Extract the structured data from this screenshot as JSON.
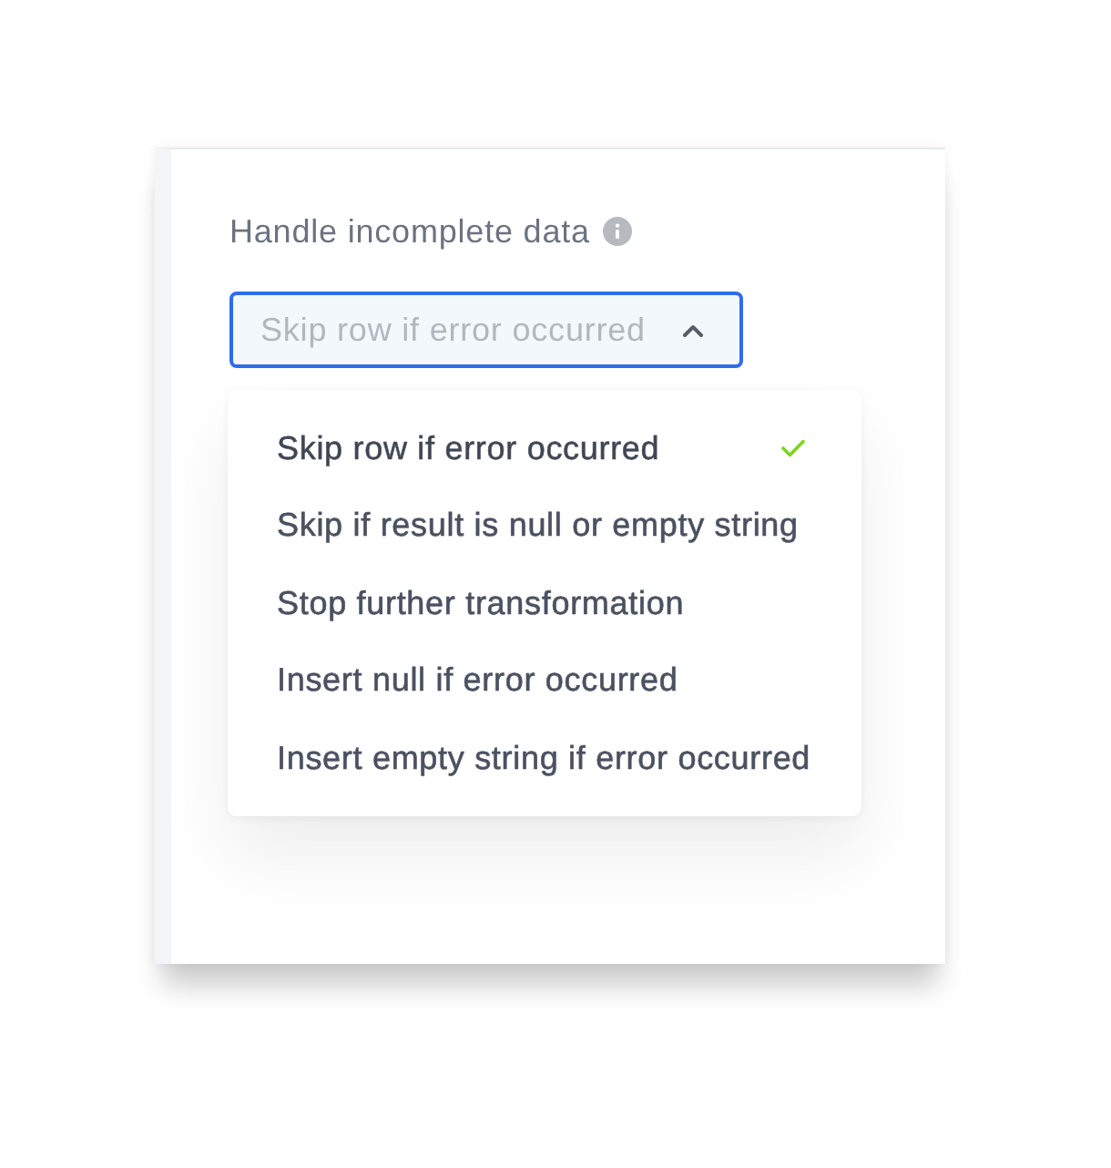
{
  "field": {
    "label": "Handle incomplete data"
  },
  "select": {
    "value": "Skip row if error occurred",
    "expanded": true
  },
  "options": [
    {
      "label": "Skip row if error occurred",
      "selected": true
    },
    {
      "label": "Skip if result is null or empty string",
      "selected": false
    },
    {
      "label": "Stop further transformation",
      "selected": false
    },
    {
      "label": "Insert null if error occurred",
      "selected": false
    },
    {
      "label": "Insert empty string if error occurred",
      "selected": false
    }
  ]
}
